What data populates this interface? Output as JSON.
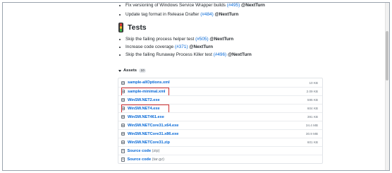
{
  "release_notes": {
    "top_items": [
      {
        "text": "Fix versioning of Windows Service Wrapper builds ",
        "issue": "(#495)",
        "mention": "@NextTurn"
      },
      {
        "text": "Update tag format in Release Drafter ",
        "issue": "(#484)",
        "mention": "@NextTurn"
      }
    ],
    "tests": {
      "title": "Tests",
      "items": [
        {
          "text": "Skip the failing process helper test ",
          "issue": "(#505)",
          "mention": "@NextTurn"
        },
        {
          "text": "Increase code coverage ",
          "issue": "(#371)",
          "mention": "@NextTurn"
        },
        {
          "text": "Skip the failing Runaway Process Killer test ",
          "issue": "(#496)",
          "mention": "@NextTurn"
        }
      ]
    }
  },
  "assets": {
    "label": "Assets",
    "count": "10",
    "items": [
      {
        "name": "sample-allOptions.xml",
        "size": "10 KB",
        "icon": "package-icon",
        "highlighted": false
      },
      {
        "name": "sample-minimal.xml",
        "size": "2.09 KB",
        "icon": "package-icon",
        "highlighted": true
      },
      {
        "name": "WinSW.NET2.exe",
        "size": "595 KB",
        "icon": "package-icon",
        "highlighted": false
      },
      {
        "name": "WinSW.NET4.exe",
        "size": "604 KB",
        "icon": "package-icon",
        "highlighted": true
      },
      {
        "name": "WinSW.NET461.exe",
        "size": "391 KB",
        "icon": "package-icon",
        "highlighted": false
      },
      {
        "name": "WinSW.NETCore31.x64.exe",
        "size": "34.4 MB",
        "icon": "package-icon",
        "highlighted": false
      },
      {
        "name": "WinSW.NETCore31.x86.exe",
        "size": "30.9 MB",
        "icon": "package-icon",
        "highlighted": false
      },
      {
        "name": "WinSW.NETCore31.zip",
        "size": "601 KB",
        "icon": "package-icon",
        "highlighted": false
      },
      {
        "name": "Source code",
        "suffix": "(zip)",
        "size": "",
        "icon": "zip-file-icon",
        "highlighted": false
      },
      {
        "name": "Source code",
        "suffix": "(tar.gz)",
        "size": "",
        "icon": "zip-file-icon",
        "highlighted": false
      }
    ]
  },
  "colors": {
    "link": "#0366d6",
    "highlight": "#d02f2f",
    "traffic_light": [
      "#e23c3c",
      "#f3c12b",
      "#3fb950"
    ]
  }
}
